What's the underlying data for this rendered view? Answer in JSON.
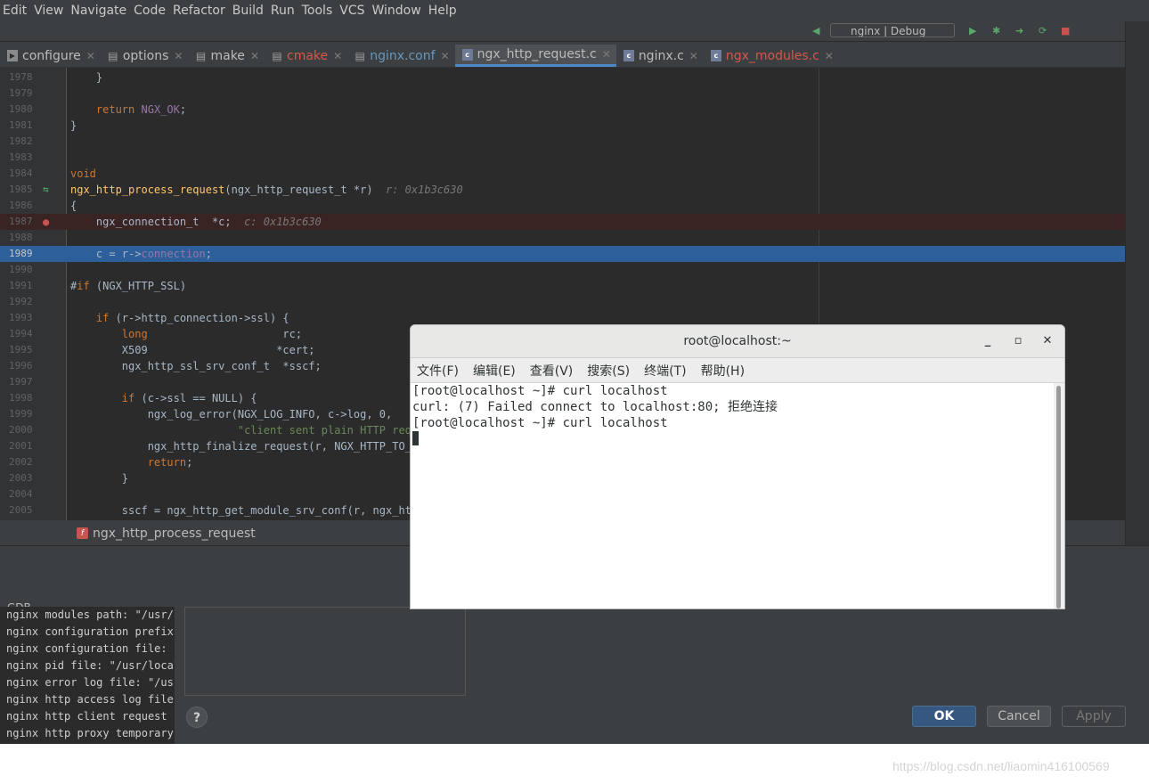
{
  "menubar": [
    "Edit",
    "View",
    "Navigate",
    "Code",
    "Refactor",
    "Build",
    "Run",
    "Tools",
    "VCS",
    "Window",
    "Help"
  ],
  "run_config": "nginx | Debug",
  "tabs": [
    {
      "label": "configure",
      "icon": "terminal-file-icon",
      "color": "#bbbbbb"
    },
    {
      "label": "options",
      "icon": "text-file-icon",
      "color": "#bbbbbb"
    },
    {
      "label": "make",
      "icon": "text-file-icon",
      "color": "#bbbbbb"
    },
    {
      "label": "cmake",
      "icon": "text-file-icon",
      "color": "#d6564a"
    },
    {
      "label": "nginx.conf",
      "icon": "text-file-icon",
      "color": "#6897bb"
    },
    {
      "label": "ngx_http_request.c",
      "icon": "c-file-icon",
      "color": "#bbbbbb"
    },
    {
      "label": "nginx.c",
      "icon": "c-file-icon",
      "color": "#bbbbbb"
    },
    {
      "label": "ngx_modules.c",
      "icon": "c-file-icon",
      "color": "#d6564a"
    }
  ],
  "editor": {
    "lines": [
      {
        "n": "1978",
        "t": "    }"
      },
      {
        "n": "1979",
        "t": ""
      },
      {
        "n": "1980",
        "t": "    return NGX_OK;"
      },
      {
        "n": "1981",
        "t": "}"
      },
      {
        "n": "1982",
        "t": ""
      },
      {
        "n": "1983",
        "t": ""
      },
      {
        "n": "1984",
        "t": "void"
      },
      {
        "n": "1985",
        "t": "ngx_http_process_request(ngx_http_request_t *r)",
        "hint": "r: 0x1b3c630"
      },
      {
        "n": "1986",
        "t": "{"
      },
      {
        "n": "1987",
        "t": "    ngx_connection_t  *c;",
        "hint": "c: 0x1b3c630"
      },
      {
        "n": "1988",
        "t": ""
      },
      {
        "n": "1989",
        "t": "    c = r->connection;"
      },
      {
        "n": "1990",
        "t": ""
      },
      {
        "n": "1991",
        "t": "#if (NGX_HTTP_SSL)"
      },
      {
        "n": "1992",
        "t": ""
      },
      {
        "n": "1993",
        "t": "    if (r->http_connection->ssl) {"
      },
      {
        "n": "1994",
        "t": "        long                     rc;"
      },
      {
        "n": "1995",
        "t": "        X509                    *cert;"
      },
      {
        "n": "1996",
        "t": "        ngx_http_ssl_srv_conf_t  *sscf;"
      },
      {
        "n": "1997",
        "t": ""
      },
      {
        "n": "1998",
        "t": "        if (c->ssl == NULL) {"
      },
      {
        "n": "1999",
        "t": "            ngx_log_error(NGX_LOG_INFO, c->log, 0,"
      },
      {
        "n": "2000",
        "t": "                          \"client sent plain HTTP requ"
      },
      {
        "n": "2001",
        "t": "            ngx_http_finalize_request(r, NGX_HTTP_TO_H"
      },
      {
        "n": "2002",
        "t": "            return;"
      },
      {
        "n": "2003",
        "t": "        }"
      },
      {
        "n": "2004",
        "t": ""
      },
      {
        "n": "2005",
        "t": "        sscf = ngx_http_get_module_srv_conf(r, ngx_http"
      }
    ]
  },
  "breadcrumb": "ngx_http_process_request",
  "gdb_label": "GDB",
  "console_lines": [
    "nginx modules path: \"/usr/l",
    "nginx configuration prefix:",
    "nginx configuration file: \"",
    "nginx pid file: \"/usr/local",
    "nginx error log file: \"/usr",
    "nginx http access log file:",
    "nginx http client request b",
    "nginx http proxy temporary "
  ],
  "dialog": {
    "help": "?",
    "ok": "OK",
    "cancel": "Cancel",
    "apply": "Apply"
  },
  "terminal": {
    "title": "root@localhost:~",
    "menu": [
      "文件(F)",
      "编辑(E)",
      "查看(V)",
      "搜索(S)",
      "终端(T)",
      "帮助(H)"
    ],
    "lines": [
      "[root@localhost ~]# curl localhost",
      "curl: (7) Failed connect to localhost:80; 拒绝连接",
      "[root@localhost ~]# curl localhost"
    ]
  },
  "watermark": "https://blog.csdn.net/liaomin416100569"
}
